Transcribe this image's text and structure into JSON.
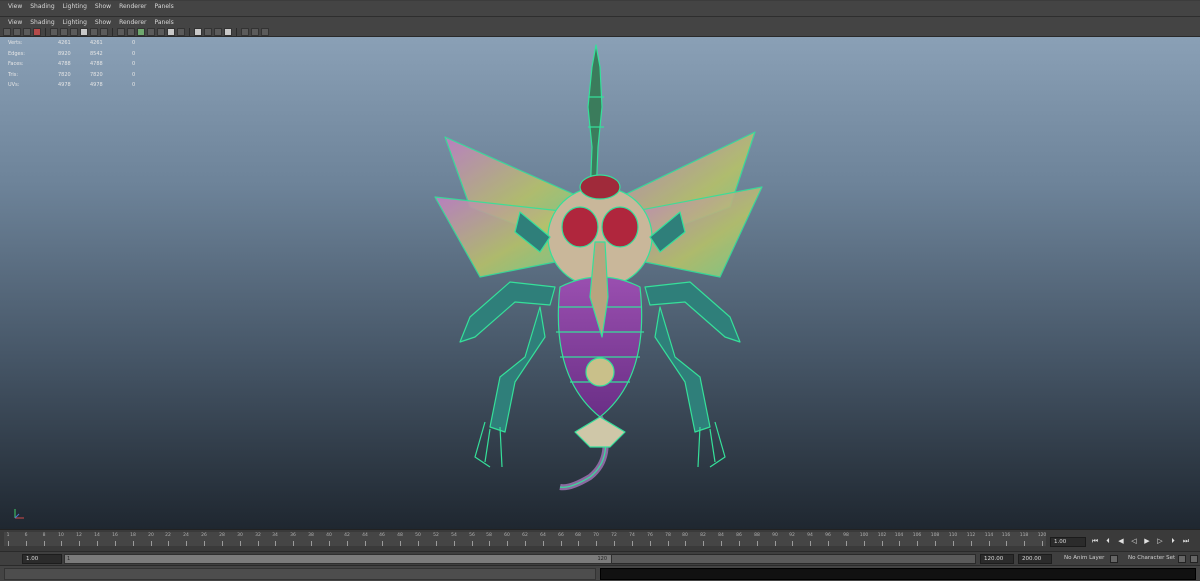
{
  "window_menu": [
    "View",
    "Shading",
    "Lighting",
    "Show",
    "Renderer",
    "Panels"
  ],
  "panel_menu": [
    "View",
    "Shading",
    "Lighting",
    "Show",
    "Renderer",
    "Panels"
  ],
  "hud_stats": [
    {
      "label": "Verts:",
      "c1": "4261",
      "c2": "4261",
      "c3": "0"
    },
    {
      "label": "Edges:",
      "c1": "8920",
      "c2": "8542",
      "c3": "0"
    },
    {
      "label": "Faces:",
      "c1": "4788",
      "c2": "4788",
      "c3": "0"
    },
    {
      "label": "Tris:",
      "c1": "7820",
      "c2": "7820",
      "c3": "0"
    },
    {
      "label": "UVs:",
      "c1": "4978",
      "c2": "4978",
      "c3": "0"
    }
  ],
  "timeline": {
    "tick_labels": [
      "1",
      "6",
      "8",
      "10",
      "12",
      "14",
      "16",
      "18",
      "20",
      "22",
      "24",
      "26",
      "28",
      "30",
      "32",
      "34",
      "36",
      "38",
      "40",
      "42",
      "44",
      "46",
      "48",
      "50",
      "52",
      "54",
      "56",
      "58",
      "60",
      "62",
      "64",
      "66",
      "68",
      "70",
      "72",
      "74",
      "76",
      "78",
      "80",
      "82",
      "84",
      "86",
      "88",
      "90",
      "92",
      "94",
      "96",
      "98",
      "100",
      "102",
      "104",
      "106",
      "108",
      "110",
      "112",
      "114",
      "116",
      "118",
      "120"
    ],
    "current_frame": "1.00"
  },
  "range": {
    "start": "1.00",
    "handle_start": "1",
    "handle_end": "120",
    "end": "120.00",
    "max": "200.00",
    "anim_layer": "No Anim Layer",
    "character_set": "No Character Set"
  },
  "icons": {
    "play_controls": [
      "go-to-start-icon",
      "step-back-key-icon",
      "step-back-icon",
      "play-back-icon",
      "play-forward-icon",
      "step-forward-icon",
      "step-forward-key-icon",
      "go-to-end-icon"
    ]
  },
  "colors": {
    "wireframe": "#35e09a",
    "viewport_top": "#8aa0b6",
    "viewport_bottom": "#1f2730"
  }
}
